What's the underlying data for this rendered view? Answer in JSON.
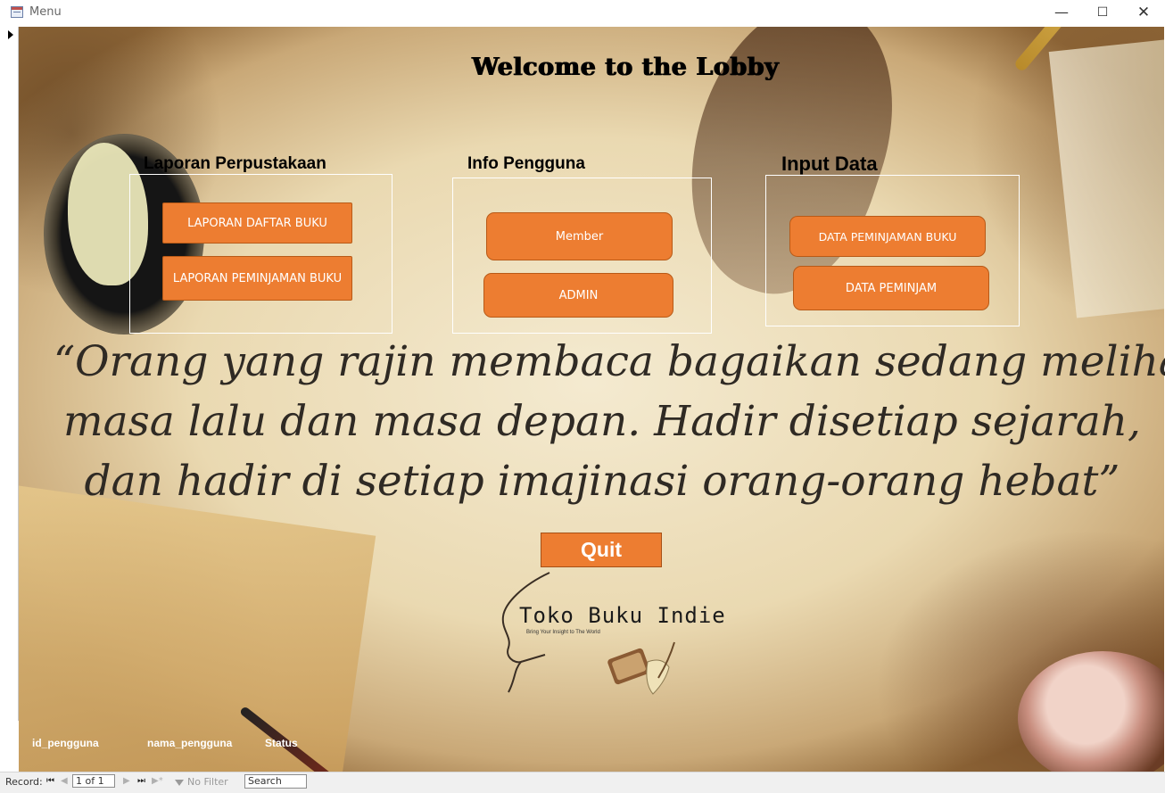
{
  "window": {
    "title": "Menu",
    "icon": "access-form-icon",
    "controls": {
      "minimize": "—",
      "maximize": "☐",
      "close": "✕"
    }
  },
  "form": {
    "welcome": "Welcome to the Lobby",
    "sections": [
      {
        "title": "Laporan Perpustakaan",
        "buttons": [
          "LAPORAN DAFTAR BUKU",
          "LAPORAN PEMINJAMAN BUKU"
        ]
      },
      {
        "title": "Info Pengguna",
        "buttons": [
          "Member",
          "ADMIN"
        ]
      },
      {
        "title": "Input  Data",
        "buttons": [
          "DATA PEMINJAMAN BUKU",
          "DATA PEMINJAM"
        ]
      }
    ],
    "quote": [
      "“Orang yang rajin membaca bagaikan sedang melihat",
      "masa lalu dan masa depan. Hadir disetiap sejarah,",
      "dan hadir di setiap imajinasi orang-orang hebat”"
    ],
    "quit_label": "Quit",
    "logo": {
      "name": "Toko Buku Indie",
      "tagline": "Bring Your Insight to The World"
    },
    "fields": [
      "id_pengguna",
      "nama_pengguna",
      "Status"
    ]
  },
  "navigation": {
    "record_label": "Record:",
    "position": "1 of 1",
    "filter_label": "No Filter",
    "search_placeholder": "Search",
    "icons": [
      "first-record-icon",
      "previous-record-icon",
      "next-record-icon",
      "last-record-icon",
      "new-record-icon",
      "filter-icon"
    ]
  },
  "colors": {
    "button": "#ed7d31",
    "button_border": "#b85a17",
    "title_text": "#000000"
  }
}
